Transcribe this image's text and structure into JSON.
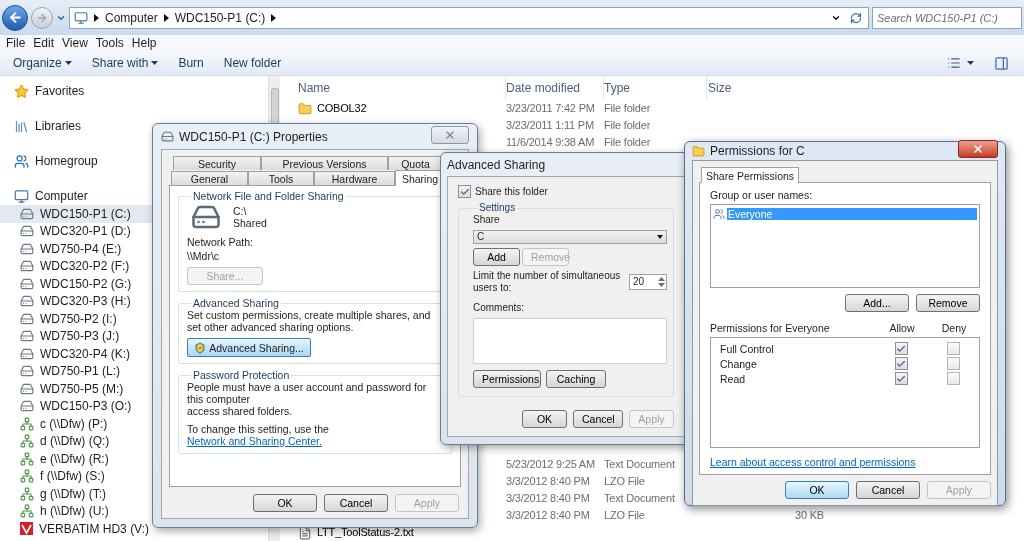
{
  "address_bar": {
    "breadcrumbs": [
      "Computer",
      "WDC150-P1 (C:)"
    ],
    "search_placeholder": "Search WDC150-P1 (C:)"
  },
  "menu_bar": [
    "File",
    "Edit",
    "View",
    "Tools",
    "Help"
  ],
  "toolbar": [
    {
      "label": "Organize",
      "has_menu": true
    },
    {
      "label": "Share with",
      "has_menu": true
    },
    {
      "label": "Burn",
      "has_menu": false
    },
    {
      "label": "New folder",
      "has_menu": false
    }
  ],
  "sidebar": {
    "items": [
      {
        "label": "Favorites",
        "kind": "favorites",
        "selected": false
      },
      {
        "label": "Libraries",
        "kind": "libraries",
        "selected": false
      },
      {
        "label": "Homegroup",
        "kind": "homegroup",
        "selected": false
      },
      {
        "label": "Computer",
        "kind": "computer",
        "selected": false,
        "children": [
          {
            "label": "WDC150-P1 (C:)",
            "kind": "drive",
            "selected": true
          },
          {
            "label": "WDC320-P1 (D:)",
            "kind": "drive",
            "selected": false
          },
          {
            "label": "WD750-P4 (E:)",
            "kind": "drive",
            "selected": false
          },
          {
            "label": "WDC320-P2 (F:)",
            "kind": "drive",
            "selected": false
          },
          {
            "label": "WDC150-P2 (G:)",
            "kind": "drive",
            "selected": false
          },
          {
            "label": "WDC320-P3 (H:)",
            "kind": "drive",
            "selected": false
          },
          {
            "label": "WD750-P2 (I:)",
            "kind": "drive",
            "selected": false
          },
          {
            "label": "WD750-P3 (J:)",
            "kind": "drive",
            "selected": false
          },
          {
            "label": "WDC320-P4 (K:)",
            "kind": "drive",
            "selected": false
          },
          {
            "label": "WD750-P1 (L:)",
            "kind": "drive",
            "selected": false
          },
          {
            "label": "WD750-P5 (M:)",
            "kind": "drive",
            "selected": false
          },
          {
            "label": "WDC150-P3 (O:)",
            "kind": "drive",
            "selected": false
          },
          {
            "label": "c (\\\\Dfw) (P:)",
            "kind": "network_drive",
            "selected": false
          },
          {
            "label": "d (\\\\Dfw) (Q:)",
            "kind": "network_drive",
            "selected": false
          },
          {
            "label": "e (\\\\Dfw) (R:)",
            "kind": "network_drive",
            "selected": false
          },
          {
            "label": "f (\\\\Dfw) (S:)",
            "kind": "network_drive",
            "selected": false
          },
          {
            "label": "g (\\\\Dfw) (T:)",
            "kind": "network_drive",
            "selected": false
          },
          {
            "label": "h (\\\\Dfw) (U:)",
            "kind": "network_drive",
            "selected": false
          },
          {
            "label": "VERBATIM HD3 (V:)",
            "kind": "removable",
            "selected": false
          }
        ]
      }
    ]
  },
  "file_list": {
    "columns": [
      "Name",
      "Date modified",
      "Type",
      "Size"
    ],
    "top_rows": [
      {
        "name": "COBOL32",
        "kind": "folder",
        "date": "3/23/2011 7:42 PM",
        "type": "File folder"
      },
      {
        "date": "3/23/2011 1:11 PM",
        "type": "File folder"
      },
      {
        "date": "11/6/2014 9:38 AM",
        "type": "File folder"
      }
    ],
    "bottom_rows": [
      {
        "date": "5/23/2012 9:25 AM",
        "type": "Text Document"
      },
      {
        "date": "3/3/2012 8:40 PM",
        "type": "LZO File"
      },
      {
        "date": "3/3/2012 8:40 PM",
        "type": "Text Document"
      },
      {
        "date": "3/3/2012 8:40 PM",
        "type": "LZO File",
        "size": "30 KB"
      },
      {
        "name": "LTT_ToolStatus-2.txt",
        "kind": "text"
      }
    ]
  },
  "properties_dialog": {
    "title": "WDC150-P1 (C:) Properties",
    "tab_rows": [
      [
        {
          "label": "Security",
          "selected": false
        },
        {
          "label": "Previous Versions",
          "selected": false
        },
        {
          "label": "Quota",
          "selected": false
        }
      ],
      [
        {
          "label": "General",
          "selected": false
        },
        {
          "label": "Tools",
          "selected": false
        },
        {
          "label": "Hardware",
          "selected": false
        },
        {
          "label": "Sharing",
          "selected": true
        }
      ]
    ],
    "network_sharing": {
      "heading": "Network File and Folder Sharing",
      "folder": "C:\\",
      "status": "Shared",
      "path_label": "Network Path:",
      "path": "\\\\Mdr\\c",
      "share_button": {
        "label": "Share...",
        "disabled": true
      }
    },
    "advanced_sharing": {
      "heading": "Advanced Sharing",
      "description": "Set custom permissions, create multiple shares, and set other advanced sharing options.",
      "button": "Advanced Sharing..."
    },
    "password_protection": {
      "heading": "Password Protection",
      "lines": [
        "People must have a user account and password for this computer",
        "access shared folders."
      ],
      "change_text": "To change this setting, use the",
      "link": "Network and Sharing Center."
    },
    "buttons": [
      {
        "label": "OK",
        "default": false,
        "disabled": false
      },
      {
        "label": "Cancel",
        "default": false,
        "disabled": false
      },
      {
        "label": "Apply",
        "default": false,
        "disabled": true
      }
    ]
  },
  "advanced_sharing_dialog": {
    "title": "Advanced Sharing",
    "share_checkbox": {
      "label": "Share this folder",
      "checked": true
    },
    "settings": {
      "heading": "Settings",
      "share_label": "Share",
      "share_name": "C",
      "add": {
        "label": "Add",
        "disabled": false
      },
      "remove": {
        "label": "Remove",
        "disabled": true
      },
      "limit_label": "Limit the number of simultaneous users to:",
      "limit_value": "20",
      "comments_label": "Comments:",
      "permissions_button": "Permissions",
      "caching_button": "Caching"
    },
    "buttons": [
      {
        "label": "OK",
        "default": false,
        "disabled": false
      },
      {
        "label": "Cancel",
        "default": false,
        "disabled": false
      },
      {
        "label": "Apply",
        "default": false,
        "disabled": true
      }
    ]
  },
  "permissions_dialog": {
    "title": "Permissions for C",
    "tabs": [
      {
        "label": "Share Permissions",
        "selected": true
      }
    ],
    "group_label": "Group or user names:",
    "users": [
      {
        "name": "Everyone",
        "selected": true
      }
    ],
    "add_button": "Add...",
    "remove_button": "Remove",
    "permissions_label": "Permissions for Everyone",
    "allow_label": "Allow",
    "deny_label": "Deny",
    "permissions": [
      {
        "name": "Full Control",
        "allow": true,
        "deny": false
      },
      {
        "name": "Change",
        "allow": true,
        "deny": false
      },
      {
        "name": "Read",
        "allow": true,
        "deny": false
      }
    ],
    "link": "Learn about access control and permissions",
    "buttons": [
      {
        "label": "OK",
        "default": true,
        "disabled": false
      },
      {
        "label": "Cancel",
        "default": false,
        "disabled": false
      },
      {
        "label": "Apply",
        "default": false,
        "disabled": true
      }
    ]
  }
}
